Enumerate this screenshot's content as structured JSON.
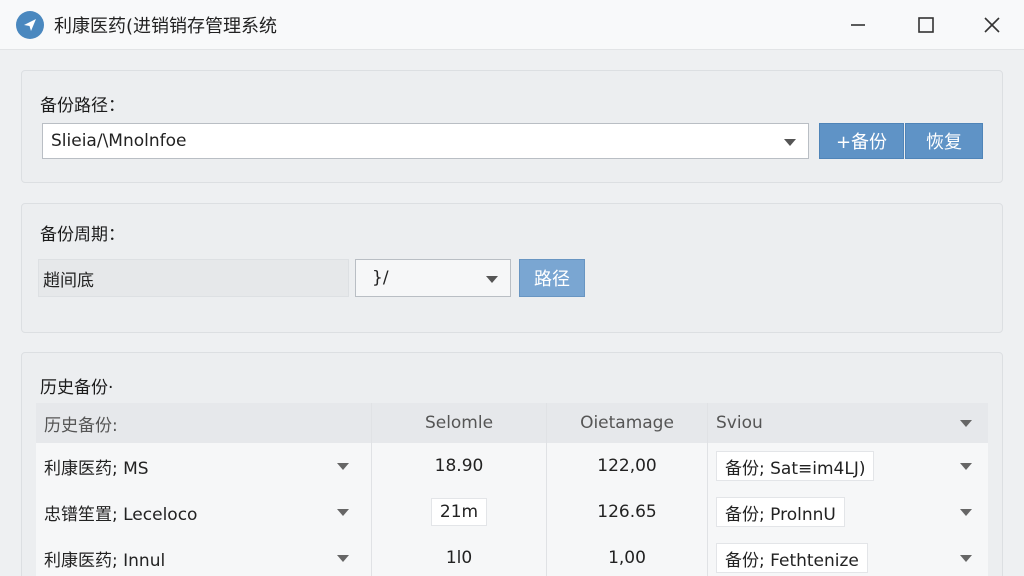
{
  "window": {
    "title": "利康医药(进销销存管理系统",
    "icon": "send-arrow-icon",
    "controls": [
      "minimize-icon",
      "maximize-icon",
      "close-icon"
    ]
  },
  "backup_path": {
    "label": "备份路径：",
    "value": "Slieia/\\Mnolnfoe",
    "backup_button": "+备份",
    "restore_button": "恢复"
  },
  "backup_cycle": {
    "label": "备份周期：",
    "field_text": "趙间底",
    "select_value": "}/",
    "path_button": "路径"
  },
  "history": {
    "label": "历史备份·",
    "columns": [
      "历史备份:",
      "Selomle",
      "Oietamage",
      "Sviou"
    ],
    "rows": [
      {
        "name": "利康医药; MS",
        "c1": "18.90",
        "c2": "122,00",
        "c3": "备份; Sat≡im4LJ)"
      },
      {
        "name": "忠镨笙置; Leceloco",
        "c1": "21m",
        "c2": "126.65",
        "c3": "备份; ProlnnU"
      },
      {
        "name": "利康医药; Innul",
        "c1": "1l0",
        "c2": "1,00",
        "c3": "备份; Fethtenize"
      }
    ]
  },
  "colors": {
    "accent_blue": "#5f93c6",
    "accent_blue_light": "#7aa6d2",
    "app_icon": "#4a88bf"
  }
}
